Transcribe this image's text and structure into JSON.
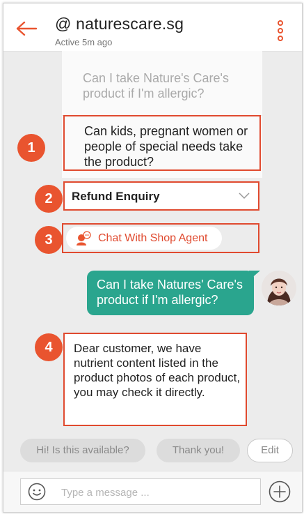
{
  "header": {
    "title": "@ naturescare.sg",
    "status": "Active 5m ago",
    "back_icon": "back-arrow-icon",
    "more_icon": "more-vertical-icon"
  },
  "faq": {
    "items": [
      "Can I take Nature's Care's product if I'm allergic?",
      "Can kids, pregnant women or people of special needs take the product?"
    ]
  },
  "category": {
    "selected": "Refund Enquiry"
  },
  "agent": {
    "label": "Chat With Shop Agent"
  },
  "messages": {
    "sent": "Can I take Natures' Care's product if I'm allergic?",
    "received": "Dear customer, we have nutrient content listed in the product photos of each product, you may check it directly."
  },
  "badges": [
    "1",
    "2",
    "3",
    "4"
  ],
  "quick_replies": {
    "items": [
      "Hi! Is this available?",
      "Thank you!"
    ],
    "edit_label": "Edit"
  },
  "input": {
    "placeholder": "Type a message ..."
  },
  "colors": {
    "accent": "#e9542f",
    "outline": "#e04a2f",
    "sent_bubble": "#2aa58e",
    "background": "#ececec"
  }
}
